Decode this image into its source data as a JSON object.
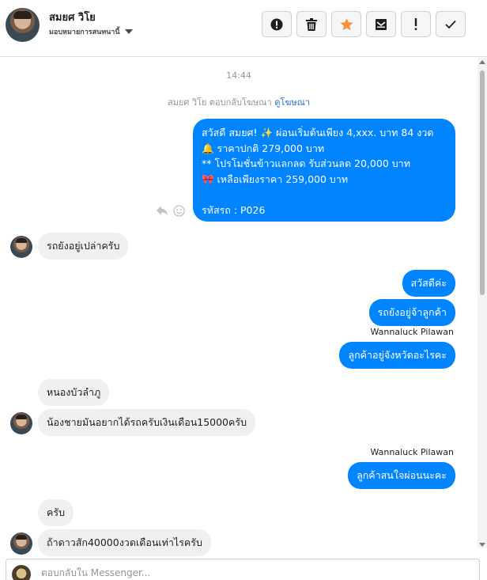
{
  "header": {
    "contact_name": "สมยศ วิโย",
    "assign_label": "มอบหมายการสนทนานี้",
    "toolbar": [
      {
        "name": "spam-button",
        "icon": "alert-circle-icon"
      },
      {
        "name": "delete-button",
        "icon": "trash-icon"
      },
      {
        "name": "star-button",
        "icon": "star-icon"
      },
      {
        "name": "mark-unread-button",
        "icon": "envelope-icon"
      },
      {
        "name": "follow-up-button",
        "icon": "exclamation-icon"
      },
      {
        "name": "done-button",
        "icon": "check-icon"
      }
    ]
  },
  "thread": {
    "timestamp": "14:44",
    "reply_note": "สมยศ วิโย ตอบกลับโฆษณา",
    "reply_link": "ดูโฆษณา",
    "ad_message": {
      "line1": "สวัสดี สมยศ! ✨  ผ่อนเริ่มต้นเพียง 4,xxx. บาท 84 งวด",
      "line2": "🔔 ราคาปกติ 279,000 บาท",
      "line3": "** โปรโมชั่นข้าวแลกลด รับส่วนลด 20,000 บาท",
      "line4": "🎀  เหลือเพียงราคา 259,000 บาท",
      "line5": "",
      "line6": " รหัสรถ : P026"
    },
    "messages": [
      {
        "text": "รถยังอยู่เปล่าครับ"
      },
      {
        "text": "สวัสดีค่ะ"
      },
      {
        "text": "รถยังอยู่จ้าลูกค้า"
      },
      {
        "text": "ลูกค้าอยู่จังหวัดอะไรคะ"
      },
      {
        "text": "หนองบัวลำภู"
      },
      {
        "text": "น้องชายมันอยากได้รถครับเงินเดือน15000ครับ"
      },
      {
        "text": "ลูกค้าสนใจผ่อนนะคะ"
      },
      {
        "text": "ครับ"
      },
      {
        "text": "ถ้าดาวสัก40000งวดเดือนเท่าไรครับ"
      }
    ],
    "sender_name_1": "Wannaluck Pilawan",
    "sender_name_2": "Wannaluck Pilawan"
  },
  "composer": {
    "placeholder": "ตอบกลับใน Messenger..."
  },
  "colors": {
    "outgoing_bubble": "#0084ff",
    "incoming_bubble": "#f0f0f0",
    "star": "#f7923b",
    "link": "#216fdb"
  }
}
